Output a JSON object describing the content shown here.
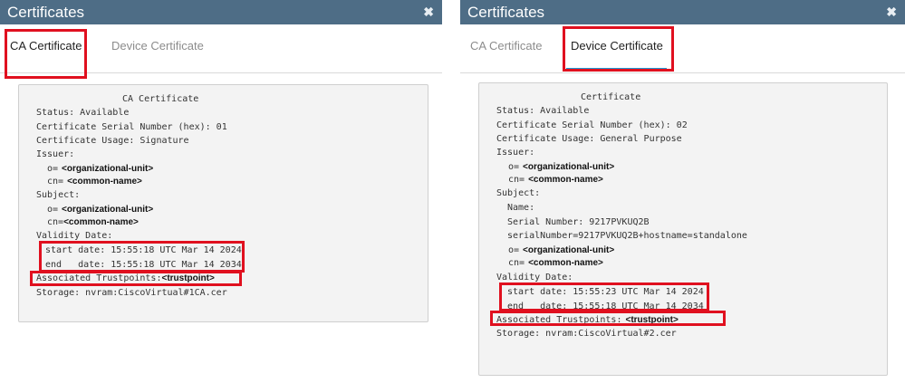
{
  "dialog_title": "Certificates",
  "tabs": {
    "ca": "CA Certificate",
    "device": "Device Certificate"
  },
  "close_glyph": "✖",
  "ca_cert": {
    "heading": "CA Certificate",
    "status": "Status: Available",
    "serial": "Certificate Serial Number (hex): 01",
    "usage": "Certificate Usage: Signature",
    "issuer_label": "Issuer:",
    "o_prefix": "o=",
    "org_unit": "<organizational-unit>",
    "cn_prefix": "cn=",
    "common_name": "<common-name>",
    "subject_label": "Subject:",
    "validity_label": "Validity Date:",
    "start": "start date: 15:55:18 UTC Mar 14 2024",
    "end": "end   date: 15:55:18 UTC Mar 14 2034",
    "trust_label": "Associated Trustpoints:",
    "trustpoint": "<trustpoint>",
    "storage": "Storage: nvram:CiscoVirtual#1CA.cer"
  },
  "device_cert": {
    "heading": "Certificate",
    "status": "Status: Available",
    "serial": "Certificate Serial Number (hex): 02",
    "usage": "Certificate Usage: General Purpose",
    "issuer_label": "Issuer:",
    "o_prefix": "o=",
    "org_unit": "<organizational-unit>",
    "cn_prefix": "cn=",
    "common_name": "<common-name>",
    "subject_label": "Subject:",
    "name_label": "Name:",
    "serial_number": "Serial Number: 9217PVKUQ2B",
    "serial_hostname": "serialNumber=9217PVKUQ2B+hostname=standalone",
    "validity_label": "Validity Date:",
    "start": "start date: 15:55:23 UTC Mar 14 2024",
    "end": "end   date: 15:55:18 UTC Mar 14 2034",
    "trust_label": "Associated Trustpoints:",
    "trustpoint": "<trustpoint>",
    "storage": "Storage: nvram:CiscoVirtual#2.cer"
  }
}
